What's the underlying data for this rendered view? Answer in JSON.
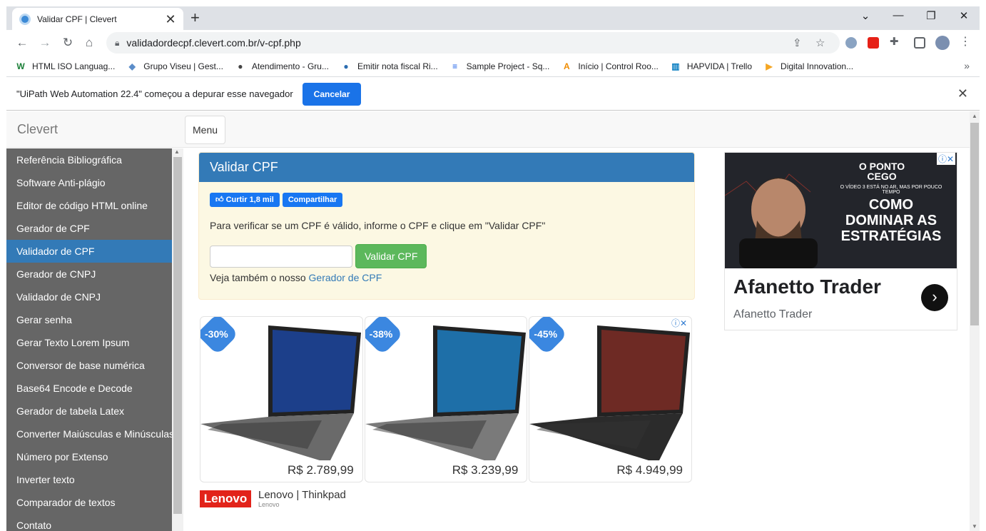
{
  "browser": {
    "tab_title": "Validar CPF | Clevert",
    "tab_close": "✕",
    "new_tab": "+",
    "url": "validadordecpf.clevert.com.br/v-cpf.php",
    "bookmarks": [
      {
        "label": "HTML ISO Languag...",
        "icon": "W",
        "color": "#1a7f37"
      },
      {
        "label": "Grupo Viseu | Gest...",
        "icon": "◆",
        "color": "#5b8dc9"
      },
      {
        "label": "Atendimento - Gru...",
        "icon": "●",
        "color": "#444"
      },
      {
        "label": "Emitir nota fiscal Ri...",
        "icon": "●",
        "color": "#2b6cb0"
      },
      {
        "label": "Sample Project - Sq...",
        "icon": "≡",
        "color": "#1d62e8"
      },
      {
        "label": "Início | Control Roo...",
        "icon": "A",
        "color": "#f08c00"
      },
      {
        "label": "HAPVIDA | Trello",
        "icon": "▥",
        "color": "#0079bf"
      },
      {
        "label": "Digital Innovation...",
        "icon": "▶",
        "color": "#f5a623"
      }
    ],
    "bookmarks_more": "»"
  },
  "infobar": {
    "message": "\"UiPath Web Automation 22.4\" começou a depurar esse navegador",
    "cancel_label": "Cancelar",
    "close": "✕"
  },
  "site": {
    "brand": "Clevert",
    "menu_label": "Menu",
    "sidebar_items": [
      "Referência Bibliográfica",
      "Software Anti-plágio",
      "Editor de código HTML online",
      "Gerador de CPF",
      "Validador de CPF",
      "Gerador de CNPJ",
      "Validador de CNPJ",
      "Gerar senha",
      "Gerar Texto Lorem Ipsum",
      "Conversor de base numérica",
      "Base64 Encode e Decode",
      "Gerador de tabela Latex",
      "Converter Maiúsculas e Minúsculas",
      "Número por Extenso",
      "Inverter texto",
      "Comparador de textos",
      "Contato"
    ],
    "active_index": 4
  },
  "panel": {
    "title": "Validar CPF",
    "like_label": "Curtir 1,8 mil",
    "share_label": "Compartilhar",
    "instruction": "Para verificar se um CPF é válido, informe o CPF e clique em \"Validar CPF\"",
    "cpf_value": "",
    "validate_label": "Validar CPF",
    "see_also_prefix": "Veja também o nosso ",
    "see_also_link": "Gerador de CPF"
  },
  "ads": {
    "products": [
      {
        "discount": "-30%",
        "price": "R$ 2.789,99"
      },
      {
        "discount": "-38%",
        "price": "R$ 3.239,99"
      },
      {
        "discount": "-45%",
        "price": "R$ 4.949,99"
      }
    ],
    "info_icon": "ⓘ✕",
    "brand_logo": "Lenovo",
    "brand_title": "Lenovo | Thinkpad",
    "brand_sub": "Lenovo"
  },
  "side_ad": {
    "brand_line": "O PONTO CEGO",
    "headline": "COMO DOMINAR AS ESTRATÉGIAS",
    "small_text": "O VÍDEO 3 ESTÁ NO AR, MAS POR POUCO TEMPO",
    "title": "Afanetto Trader",
    "subtitle": "Afanetto Trader",
    "arrow": "›",
    "info_icon": "ⓘ✕"
  }
}
